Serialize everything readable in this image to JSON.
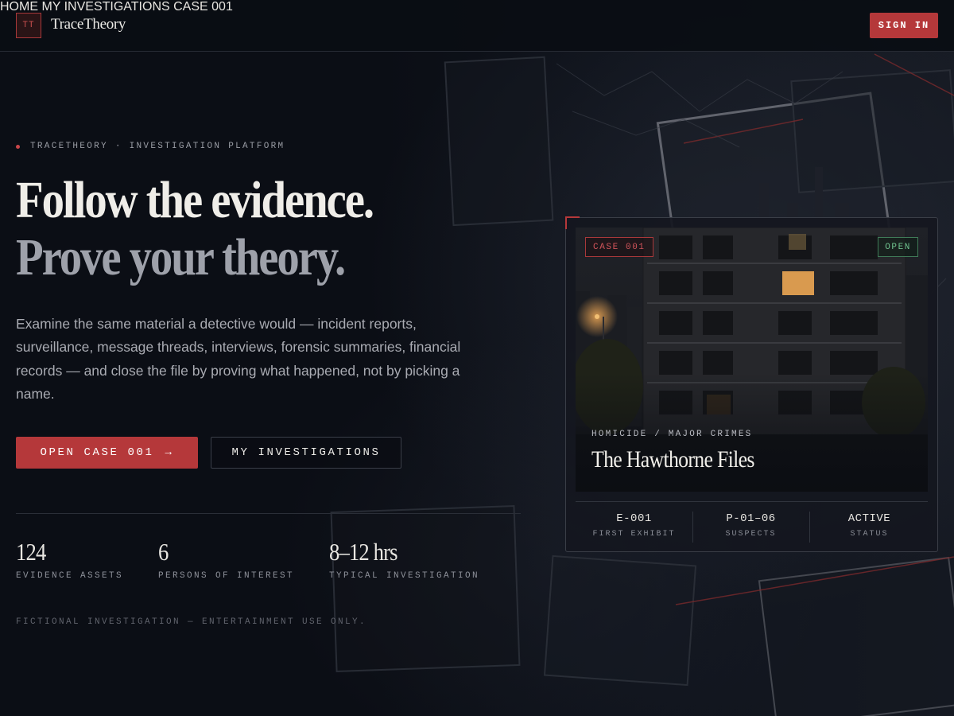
{
  "brand": {
    "mark": "TT",
    "name": "TraceTheory"
  },
  "nav": {
    "items": [
      "HOME",
      "MY INVESTIGATIONS",
      "CASE 001"
    ],
    "sign_in": "SIGN IN"
  },
  "hero": {
    "eyebrow": "TRACETHEORY · INVESTIGATION PLATFORM",
    "headline_line1": "Follow the evidence.",
    "headline_line2": "Prove your theory.",
    "lede": "Examine the same material a detective would — incident reports, surveillance, message threads, interviews, forensic summaries, financial records — and close the file by proving what happened, not by picking a name.",
    "primary_cta": "OPEN CASE 001",
    "primary_cta_icon": "→",
    "secondary_cta": "MY INVESTIGATIONS",
    "stats": [
      {
        "value": "124",
        "label": "EVIDENCE ASSETS"
      },
      {
        "value": "6",
        "label": "PERSONS OF INTEREST"
      },
      {
        "value": "8–12 hrs",
        "label": "TYPICAL INVESTIGATION"
      }
    ],
    "disclaimer": "FICTIONAL INVESTIGATION — ENTERTAINMENT USE ONLY."
  },
  "case_card": {
    "badge": "CASE 001",
    "status_badge": "OPEN",
    "category": "HOMICIDE / MAJOR CRIMES",
    "title": "The Hawthorne Files",
    "meta": [
      {
        "value": "E-001",
        "label": "FIRST EXHIBIT"
      },
      {
        "value": "P-01–06",
        "label": "SUSPECTS"
      },
      {
        "value": "ACTIVE",
        "label": "STATUS"
      }
    ]
  },
  "colors": {
    "background": "#0b0e15",
    "accent_red": "#b5383a",
    "open_green": "#6fc28e",
    "text_primary": "#efede8",
    "text_muted": "#9ea1aa"
  }
}
